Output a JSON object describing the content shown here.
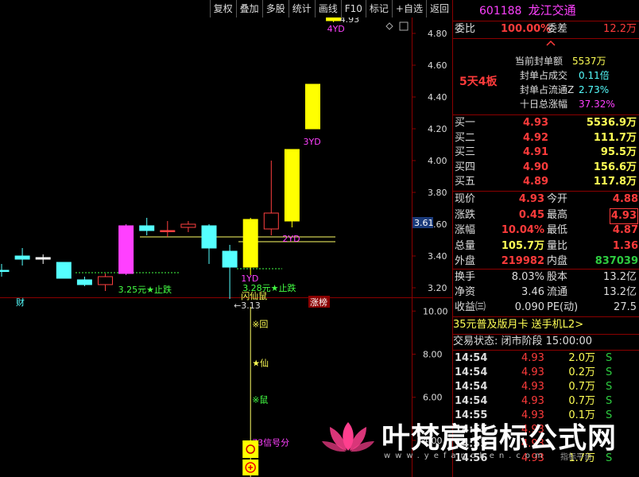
{
  "menu": [
    "复权",
    "叠加",
    "多股",
    "统计",
    "画线",
    "F10",
    "标记",
    "+自选",
    "返回"
  ],
  "stock": {
    "code": "601188",
    "name": "龙江交通"
  },
  "weibi": {
    "label": "委比",
    "value": "100.00%",
    "diff_label": "委差",
    "diff_value": "12.2万"
  },
  "seal": {
    "badge": "5天4板",
    "rows": [
      {
        "label": "当前封单额",
        "value": "5537万"
      },
      {
        "label": "封单占成交",
        "value": "0.11倍"
      },
      {
        "label": "封单占流通Z",
        "value": "2.73%"
      },
      {
        "label": "十日总涨幅",
        "value": "37.32%"
      }
    ]
  },
  "bids": [
    {
      "label": "买一",
      "price": "4.93",
      "vol": "5536.9万"
    },
    {
      "label": "买二",
      "price": "4.92",
      "vol": "111.7万"
    },
    {
      "label": "买三",
      "price": "4.91",
      "vol": "95.5万"
    },
    {
      "label": "买四",
      "price": "4.90",
      "vol": "156.6万"
    },
    {
      "label": "买五",
      "price": "4.89",
      "vol": "117.8万"
    }
  ],
  "quote": [
    {
      "l1": "现价",
      "v1": "4.93",
      "l2": "今开",
      "v2": "4.88"
    },
    {
      "l1": "涨跌",
      "v1": "0.45",
      "l2": "最高",
      "v2": "4.93"
    },
    {
      "l1": "涨幅",
      "v1": "10.04%",
      "l2": "最低",
      "v2": "4.87"
    },
    {
      "l1": "总量",
      "v1": "105.7万",
      "l2": "量比",
      "v2": "1.36"
    },
    {
      "l1": "外盘",
      "v1": "219982",
      "l2": "内盘",
      "v2": "837039"
    }
  ],
  "fund": [
    {
      "l1": "换手",
      "v1": "8.03%",
      "l2": "股本",
      "v2": "13.2亿"
    },
    {
      "l1": "净资",
      "v1": "3.46",
      "l2": "流通",
      "v2": "13.2亿"
    },
    {
      "l1": "收益㈢",
      "v1": "0.090",
      "l2": "PE(动)",
      "v2": "27.5"
    }
  ],
  "promo": "35元普及版月卡 送手机L2>",
  "trade_status": "交易状态: 闭市阶段 15:00:00",
  "ticks": [
    {
      "time": "14:54",
      "price": "4.93",
      "vol": "2.0万",
      "side": "S"
    },
    {
      "time": "14:54",
      "price": "4.93",
      "vol": "0.2万",
      "side": "S"
    },
    {
      "time": "14:54",
      "price": "4.93",
      "vol": "0.7万",
      "side": "S"
    },
    {
      "time": "14:54",
      "price": "4.93",
      "vol": "0.7万",
      "side": "S"
    },
    {
      "time": "14:55",
      "price": "4.93",
      "vol": "0.1万",
      "side": "S"
    },
    {
      "time": "14:55",
      "price": "4.93",
      "vol": "",
      "side": ""
    },
    {
      "time": "14:55",
      "price": "4.93",
      "vol": "",
      "side": ""
    },
    {
      "time": "14:56",
      "price": "4.93",
      "vol": "1.7万",
      "side": "S"
    }
  ],
  "watermark": {
    "text": "叶梵宸指标公式网",
    "url": "www.yefanchen.com",
    "faded": "指标平台"
  },
  "chart_data": {
    "type": "candlestick",
    "price_axis": [
      4.8,
      4.6,
      4.4,
      4.2,
      4.0,
      3.8,
      3.6,
      3.4,
      3.2
    ],
    "ylim": [
      3.14,
      4.9
    ],
    "current_price_tag": "3.61",
    "candles": [
      {
        "o": 3.31,
        "c": 3.31,
        "h": 3.35,
        "l": 3.27,
        "color": "cyan-cross"
      },
      {
        "o": 3.4,
        "c": 3.38,
        "h": 3.45,
        "l": 3.34,
        "color": "cyan"
      },
      {
        "o": 3.39,
        "c": 3.38,
        "h": 3.41,
        "l": 3.35,
        "color": "white-cross"
      },
      {
        "o": 3.36,
        "c": 3.26,
        "h": 3.36,
        "l": 3.26,
        "color": "cyan"
      },
      {
        "o": 3.25,
        "c": 3.22,
        "h": 3.27,
        "l": 3.21,
        "color": "cyan"
      },
      {
        "o": 3.22,
        "c": 3.27,
        "h": 3.29,
        "l": 3.18,
        "color": "red"
      },
      {
        "o": 3.29,
        "c": 3.59,
        "h": 3.6,
        "l": 3.28,
        "color": "magenta"
      },
      {
        "o": 3.59,
        "c": 3.56,
        "h": 3.64,
        "l": 3.53,
        "color": "cyan"
      },
      {
        "o": 3.56,
        "c": 3.56,
        "h": 3.62,
        "l": 3.52,
        "color": "red-cross"
      },
      {
        "o": 3.6,
        "c": 3.58,
        "h": 3.62,
        "l": 3.55,
        "color": "red"
      },
      {
        "o": 3.59,
        "c": 3.45,
        "h": 3.6,
        "l": 3.35,
        "color": "cyan"
      },
      {
        "o": 3.43,
        "c": 3.33,
        "h": 3.47,
        "l": 3.13,
        "color": "cyan"
      },
      {
        "o": 3.33,
        "c": 3.63,
        "h": 3.64,
        "l": 3.28,
        "color": "yellow"
      },
      {
        "o": 3.57,
        "c": 3.67,
        "h": 4.0,
        "l": 3.53,
        "color": "red"
      },
      {
        "o": 3.62,
        "c": 4.07,
        "h": 4.07,
        "l": 3.58,
        "color": "yellow"
      },
      {
        "o": 4.2,
        "c": 4.48,
        "h": 4.48,
        "l": 4.2,
        "color": "yellow"
      },
      {
        "o": 4.88,
        "c": 4.93,
        "h": 4.93,
        "l": 4.87,
        "color": "yellow"
      }
    ],
    "annotations": [
      {
        "text": "4.93",
        "price": 4.93,
        "idx": 16,
        "color": "#ddd"
      },
      {
        "text": "4YD",
        "price": 4.87,
        "idx": 16,
        "color": "#ff40ff"
      },
      {
        "text": "3YD",
        "price": 4.16,
        "idx": 15,
        "color": "#ff40ff"
      },
      {
        "text": "2YD",
        "price": 3.55,
        "idx": 14,
        "color": "#ff40ff"
      },
      {
        "text": "1YD",
        "price": 3.3,
        "idx": 12,
        "color": "#ff40ff"
      },
      {
        "text": "3.25元★止跌",
        "price": 3.23,
        "idx": 6,
        "color": "#44ff44"
      },
      {
        "text": "3.28元★止跌",
        "price": 3.24,
        "idx": 12,
        "color": "#44ff44"
      },
      {
        "text": "←3.13",
        "price": 3.13,
        "idx": 11,
        "color": "#ddd"
      },
      {
        "text": "闪仙鼠",
        "price": 3.19,
        "idx": 12,
        "color": "#ffff55"
      }
    ],
    "tags": {
      "finance": "财",
      "limit_up": "涨榜"
    },
    "indicator": {
      "axis": [
        10.0,
        8.0,
        6.0,
        4.0
      ],
      "ylim": [
        2.3,
        10.6
      ],
      "signals": [
        "※回",
        "★仙",
        "※鼠",
        "73信号分"
      ]
    }
  }
}
